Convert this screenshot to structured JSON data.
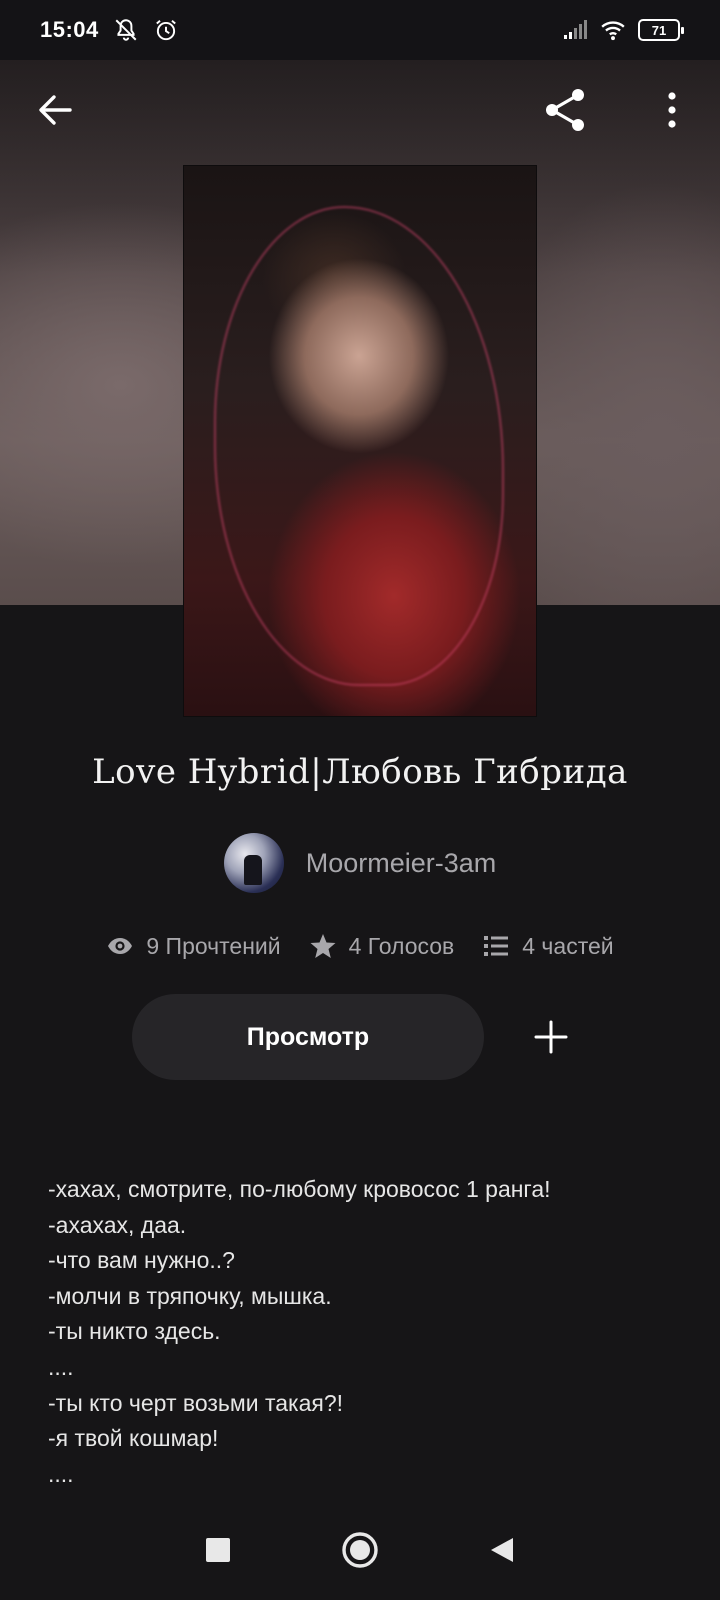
{
  "status_bar": {
    "time": "15:04",
    "battery": "71"
  },
  "toolbar": {
    "back_icon": "arrow-left-icon",
    "share_icon": "share-icon",
    "more_icon": "more-vertical-icon"
  },
  "book": {
    "title": "Love Hybrid|Любовь Гибрида",
    "author": "Moormeier-3am",
    "stats": {
      "reads": "9 Прочтений",
      "votes": "4 Голосов",
      "parts": "4 частей"
    },
    "view_label": "Просмотр",
    "description": [
      "-хахах, смотрите, по-любому кровосос 1 ранга!",
      "-ахахах, даа.",
      "-что вам нужно..?",
      "-молчи в тряпочку, мышка.",
      "-ты никто здесь.",
      "....",
      "-ты кто черт возьми такая?!",
      "-я твой кошмар!",
      "...."
    ]
  },
  "colors": {
    "background": "#161517",
    "button_bg": "#262528",
    "muted_text": "#a8a7ab"
  }
}
